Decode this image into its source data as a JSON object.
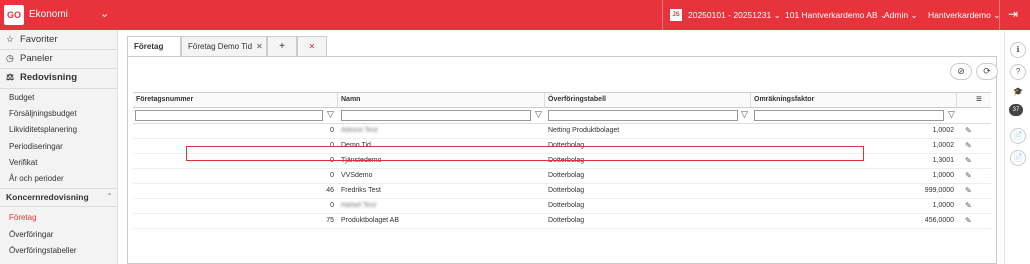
{
  "topbar": {
    "logo": "GO",
    "app_name": "Ekonomi",
    "app_chevron": "⌄",
    "js_badge": "JS",
    "period": "20250101 - 20251231",
    "period_chevron": "⌄",
    "company": "101 Hantverkardemo AB",
    "company_chevron": "⌄",
    "user": "Admin",
    "user_chevron": "⌄",
    "account": "Hantverkardemo",
    "account_chevron": "⌄",
    "logout_icon": "⇥"
  },
  "sidebar": {
    "favorites": {
      "icon": "☆",
      "label": "Favoriter"
    },
    "panels": {
      "icon": "◷",
      "label": "Paneler"
    },
    "accounting": {
      "icon": "⚖",
      "label": "Redovisning"
    },
    "accounting_items": [
      "Budget",
      "Försäljningsbudget",
      "Likviditetsplanering",
      "Periodiseringar",
      "Verifikat",
      "År och perioder"
    ],
    "group_section": {
      "label": "Koncernredovisning",
      "caret": "⌃"
    },
    "group_items": [
      "Företag",
      "Överföringar",
      "Överföringstabeller"
    ]
  },
  "tabs": [
    {
      "label": "Företag",
      "close": ""
    },
    {
      "label": "Företag Demo Tid",
      "close": "✕"
    },
    {
      "label": "+",
      "close": ""
    },
    {
      "label": "✕",
      "close": ""
    }
  ],
  "toolbar": {
    "clear_filter_icon": "⊘",
    "refresh_icon": "⟳"
  },
  "grid": {
    "columns": [
      "Företagsnummer",
      "Namn",
      "Överföringstabell",
      "Omräkningsfaktor"
    ],
    "menu_icon": "≡",
    "filter_icon": "▽",
    "edit_icon": "✎",
    "rows": [
      {
        "number": "0",
        "name": "Adirest Test",
        "table": "Netting Produktbolaget",
        "factor": "1,0002"
      },
      {
        "number": "0",
        "name": "Demo Tid",
        "table": "Dotterbolag",
        "factor": "1,0002"
      },
      {
        "number": "0",
        "name": "Tjänstedemo",
        "table": "Dotterbolag",
        "factor": "1,3001"
      },
      {
        "number": "0",
        "name": "VVSdemo",
        "table": "Dotterbolag",
        "factor": "1,0000"
      },
      {
        "number": "46",
        "name": "Fredriks Test",
        "table": "Dotterbolag",
        "factor": "999,0000"
      },
      {
        "number": "0",
        "name": "Hafsef Test",
        "table": "Dotterbolag",
        "factor": "1,0000"
      },
      {
        "number": "75",
        "name": "Produktbolaget AB",
        "table": "Dotterbolag",
        "factor": "456,0000"
      }
    ]
  },
  "rightbar": {
    "info": "ℹ",
    "help": "?",
    "academy": "🎓",
    "badge": "37",
    "doc1": "📄",
    "doc2": "📄"
  }
}
